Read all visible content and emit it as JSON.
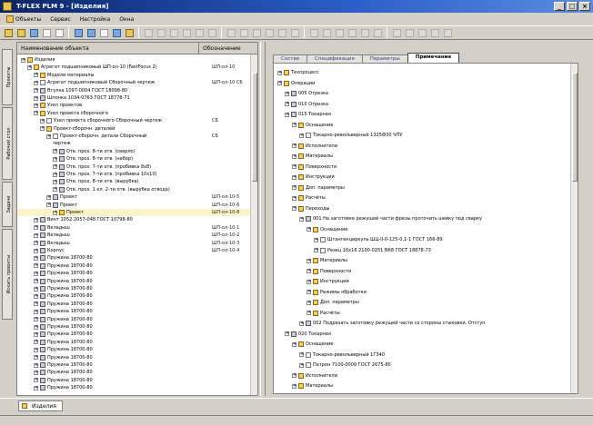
{
  "window": {
    "title": "T-FLEX PLM 9 - [Изделия]"
  },
  "menu": [
    "Объекты",
    "Сервис",
    "Настройка",
    "Окна"
  ],
  "side_tabs": [
    "Проекты",
    "Рабочий стол",
    "Задачи",
    "Искать проекты"
  ],
  "left_panel": {
    "columns": [
      "Наименование объекта",
      "Обозначение"
    ],
    "rows": [
      {
        "label": "Изделия",
        "designation": ""
      },
      {
        "label": "Агрегат подшипниковый ШП-ол-10 (FastFocus 2)",
        "designation": "ШП-ол-10"
      },
      {
        "label": "Модели материалы",
        "designation": ""
      },
      {
        "label": "Агрегат подшипниковый Сборочный чертеж",
        "designation": "ШП-ол-10 СБ"
      },
      {
        "label": "Втулка 1097-0004 ГОСТ 18098-80",
        "designation": ""
      },
      {
        "label": "Шпонка 1034-0763 ГОСТ 18778-71",
        "designation": ""
      },
      {
        "label": "Узел проектов",
        "designation": ""
      },
      {
        "label": "Узел проекта сборочного",
        "designation": ""
      },
      {
        "label": "Узел проекта сборочного Сборочный чертеж",
        "designation": "СБ"
      },
      {
        "label": "Проект-сборочн. деталей",
        "designation": ""
      },
      {
        "label": "Проект-сборочн. детали Сборочный",
        "designation": "СБ"
      },
      {
        "label": "чертеж",
        "designation": ""
      },
      {
        "label": "Отв. прох. 8-ти отв. (сверло)",
        "designation": ""
      },
      {
        "label": "Отв. прох. 8-ти отв. (набор)",
        "designation": ""
      },
      {
        "label": "Отв. прох. 7-ти отв. (пробивка 8х8)",
        "designation": ""
      },
      {
        "label": "Отв. прох. 7-ти отв. (пробивка 10х10)",
        "designation": ""
      },
      {
        "label": "Отв. прох. 8-ти отв. (вырубка)",
        "designation": ""
      },
      {
        "label": "Отв. прох. 1 кл. 2-ти отв. (вырубка отвода)",
        "designation": ""
      },
      {
        "label": "Проект",
        "designation": "ШП-ол-10-5"
      },
      {
        "label": "Проект",
        "designation": "ШП-ол-10-6"
      },
      {
        "label": "Проект",
        "designation": "ШП-ол-10-8"
      },
      {
        "label": "Винт 1052-2057-048 ГОСТ 10798-80",
        "designation": ""
      },
      {
        "label": "Вкладыш",
        "designation": "ШП-ол-10-1"
      },
      {
        "label": "Вкладыш",
        "designation": "ШП-ол-10-2"
      },
      {
        "label": "Вкладыш",
        "designation": "ШП-ол-10-3"
      },
      {
        "label": "Корпус",
        "designation": "ШП-ол-10-4"
      },
      {
        "label": "Пружина 18700-80",
        "designation": ""
      },
      {
        "label": "Пружина 18700-80",
        "designation": ""
      },
      {
        "label": "Пружина 18700-80",
        "designation": ""
      },
      {
        "label": "Пружина 18700-80",
        "designation": ""
      },
      {
        "label": "Пружина 18700-80",
        "designation": ""
      },
      {
        "label": "Пружина 18700-80",
        "designation": ""
      },
      {
        "label": "Пружина 18700-80",
        "designation": ""
      },
      {
        "label": "Пружина 18700-80",
        "designation": ""
      },
      {
        "label": "Пружина 18700-80",
        "designation": ""
      },
      {
        "label": "Пружина 18700-80",
        "designation": ""
      },
      {
        "label": "Пружина 18700-80",
        "designation": ""
      },
      {
        "label": "Пружина 18700-80",
        "designation": ""
      },
      {
        "label": "Пружина 18700-80",
        "designation": ""
      },
      {
        "label": "Пружина 18700-80",
        "designation": ""
      },
      {
        "label": "Пружина 18700-80",
        "designation": ""
      },
      {
        "label": "Пружина 18700-80",
        "designation": ""
      },
      {
        "label": "Пружина 18700-80",
        "designation": ""
      },
      {
        "label": "Пружина 18700-80",
        "designation": ""
      }
    ]
  },
  "right_panel": {
    "tabs": [
      "Состав",
      "Спецификация",
      "Параметры",
      "Примечание"
    ],
    "tree": [
      "Техпроцесс",
      "Операции",
      "005 Отрезка",
      "010 Отрезка",
      "015 Токарная",
      "Оснащение",
      "Токарно-револьверный 1325Ф30 ЧПУ",
      "Исполнители",
      "Материалы",
      "Поверхности",
      "Инструкции",
      "Доп. параметры",
      "Расчёты",
      "Переходы",
      "001 Нa заготовке режущей части фрезы проточить шейку под сварку",
      "Оснащение",
      "Штангенциркуль ШЦ-II-0-125-0,1-1 ГОСТ 166-89",
      "Резец 16х16 2100-0251 ВК8 ГОСТ 18878-73",
      "Материалы",
      "Поверхности",
      "Инструкции",
      "Режимы обработки",
      "Доп. параметры",
      "Расчёты",
      "002 Подрезать заготовку режущей части со стороны стыковки. Отступ",
      "020 Токарная",
      "Оснащение",
      "Токарно-револьверный 1Г340",
      "Патрон 7100-0009 ГОСТ 2675-80",
      "Исполнители",
      "Материалы"
    ]
  },
  "bottom_tab": "Изделия"
}
